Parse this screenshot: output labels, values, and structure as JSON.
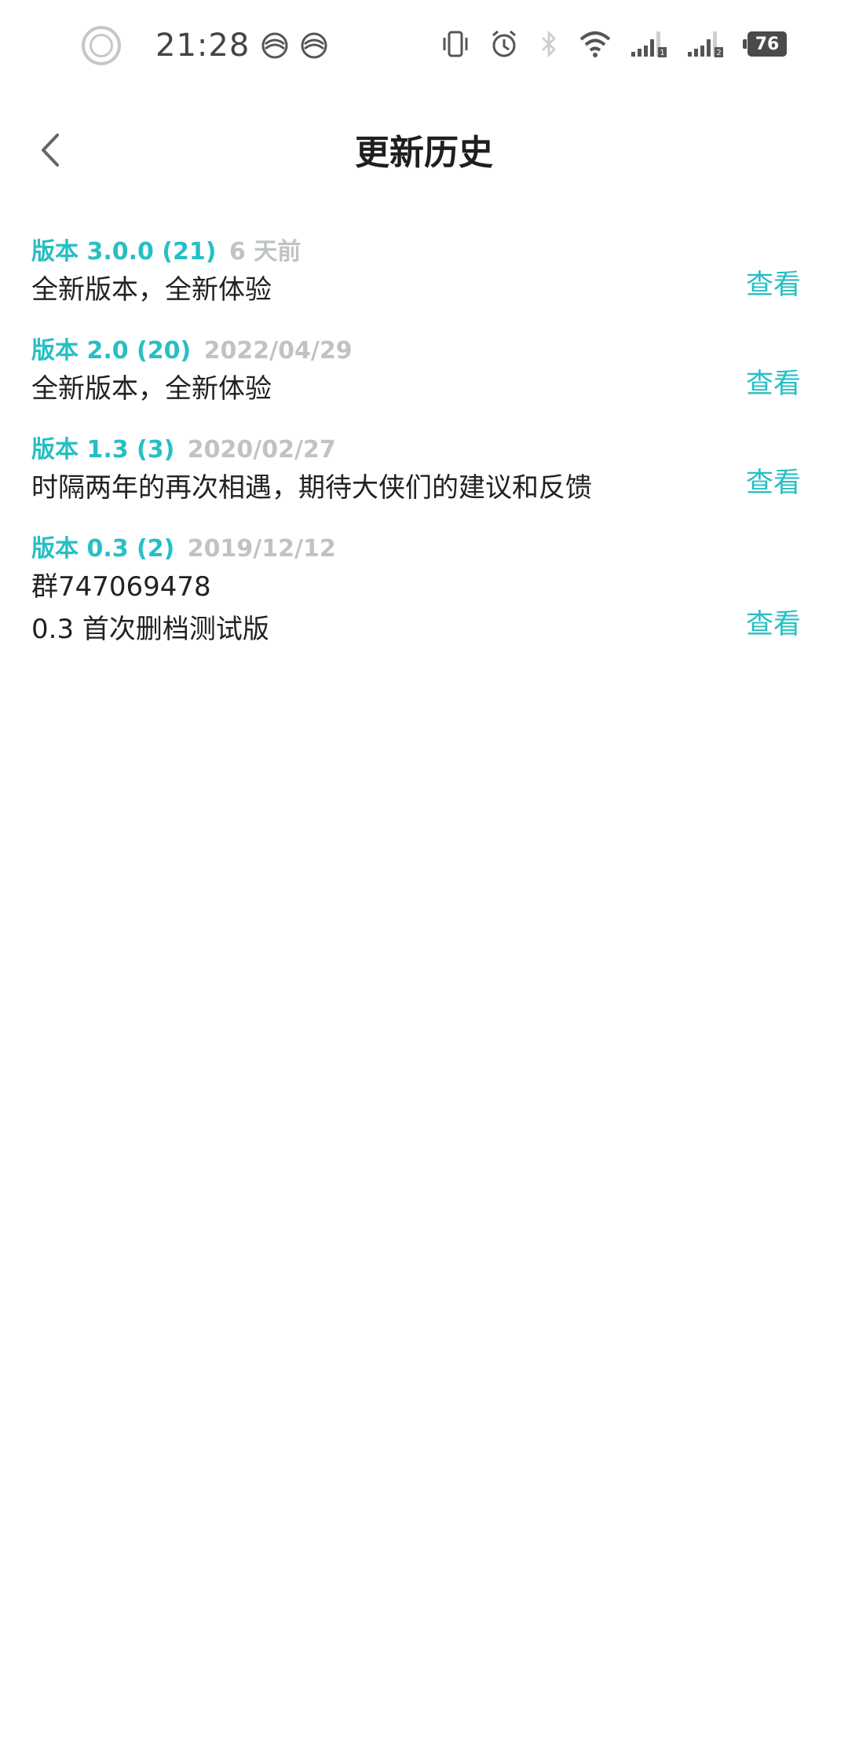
{
  "status_bar": {
    "time": "21:28",
    "battery": "76"
  },
  "header": {
    "title": "更新历史"
  },
  "history": [
    {
      "version": "版本 3.0.0 (21)",
      "date": "6 天前",
      "lines": [
        "全新版本，全新体验"
      ],
      "action": "查看"
    },
    {
      "version": "版本 2.0 (20)",
      "date": "2022/04/29",
      "lines": [
        "全新版本，全新体验"
      ],
      "action": "查看"
    },
    {
      "version": "版本 1.3 (3)",
      "date": "2020/02/27",
      "lines": [
        "时隔两年的再次相遇，期待大侠们的建议和反馈"
      ],
      "action": "查看"
    },
    {
      "version": "版本 0.3 (2)",
      "date": "2019/12/12",
      "lines": [
        "群747069478",
        "0.3 首次删档测试版"
      ],
      "action": "查看"
    }
  ],
  "colors": {
    "accent": "#26bfc4",
    "muted": "#bfc3c5",
    "text": "#222222"
  }
}
